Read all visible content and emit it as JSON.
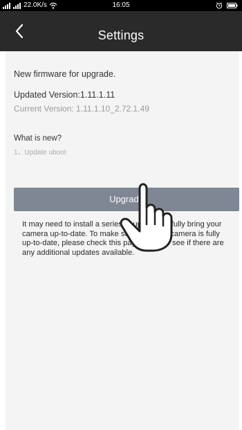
{
  "status_bar": {
    "network_speed": "22.0K/s",
    "time": "16:05"
  },
  "header": {
    "back_icon": "chevron-left-icon",
    "title": "Settings"
  },
  "firmware": {
    "heading": "New firmware for upgrade.",
    "updated_version": "Updated Version:1.11.1.11",
    "current_version": "Current Version: 1.11.1.10_2.72.1.49"
  },
  "whats_new": {
    "heading": "What is new?",
    "items": [
      "1、Update uboot"
    ]
  },
  "upgrade": {
    "label": "Upgrade"
  },
  "note": {
    "text": "It may need to install a series of updates to fully bring your camera up-to-date. To make sure that your camera is fully up-to-date, please check this page again to see if there are any additional updates available."
  },
  "colors": {
    "header_bg": "#2a2a2a",
    "content_bg": "#f4f4f4",
    "button_bg": "#7f8694"
  }
}
